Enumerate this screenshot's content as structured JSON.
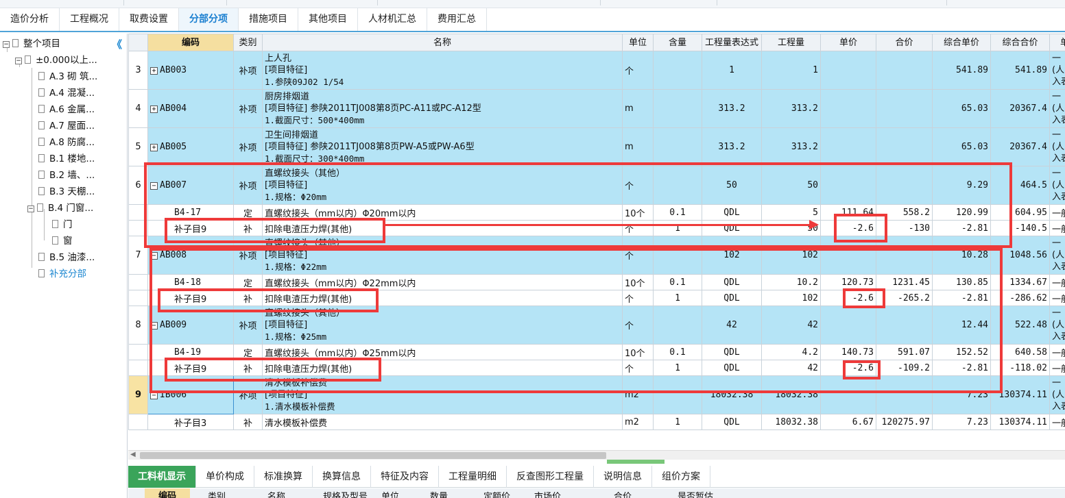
{
  "tabs": [
    "造价分析",
    "工程概况",
    "取费设置",
    "分部分项",
    "措施项目",
    "其他项目",
    "人材机汇总",
    "费用汇总"
  ],
  "active_tab": "分部分项",
  "tree": {
    "collapse_glyph": "《",
    "items": [
      {
        "label": "整个项目"
      },
      {
        "label": "±0.000以上..."
      },
      {
        "label": "A.3 砌 筑..."
      },
      {
        "label": "A.4 混凝..."
      },
      {
        "label": "A.6 金属..."
      },
      {
        "label": "A.7 屋面..."
      },
      {
        "label": "A.8 防腐..."
      },
      {
        "label": "B.1 楼地..."
      },
      {
        "label": "B.2 墙、..."
      },
      {
        "label": "B.3 天棚..."
      },
      {
        "label": "B.4 门窗..."
      },
      {
        "label": "门"
      },
      {
        "label": "窗"
      },
      {
        "label": "B.5 油漆..."
      },
      {
        "label": "补充分部"
      }
    ]
  },
  "columns": [
    "",
    "编码",
    "类别",
    "名称",
    "单位",
    "含量",
    "工程量表达式",
    "工程量",
    "单价",
    "合价",
    "综合单价",
    "综合合价",
    "单价"
  ],
  "rows": [
    {
      "rn": "3",
      "code": "AB003",
      "type": "补项",
      "name": [
        "上人孔",
        "[项目特征]",
        "1.参陕09J02 1/54"
      ],
      "unit": "个",
      "content": "",
      "expr": "1",
      "qty": "1",
      "price": "",
      "total": "",
      "cprice": "541.89",
      "ctotal": "541.89",
      "last": [
        "一",
        "(人",
        "入表"
      ]
    },
    {
      "rn": "4",
      "code": "AB004",
      "type": "补项",
      "name": [
        "厨房排烟道",
        "[项目特征]  参陕2011TJ008第8页PC-A11或PC-A12型",
        "1.截面尺寸：500*400mm"
      ],
      "unit": "m",
      "content": "",
      "expr": "313.2",
      "qty": "313.2",
      "price": "",
      "total": "",
      "cprice": "65.03",
      "ctotal": "20367.4",
      "last": [
        "一",
        "(人",
        "入表"
      ]
    },
    {
      "rn": "5",
      "code": "AB005",
      "type": "补项",
      "name": [
        "卫生间排烟道",
        "[项目特征]  参陕2011TJ008第8页PW-A5或PW-A6型",
        "1.截面尺寸：300*400mm"
      ],
      "unit": "m",
      "content": "",
      "expr": "313.2",
      "qty": "313.2",
      "price": "",
      "total": "",
      "cprice": "65.03",
      "ctotal": "20367.4",
      "last": [
        "一",
        "(人",
        "入表"
      ]
    },
    {
      "rn": "6",
      "code": "AB007",
      "type": "补项",
      "name": [
        "直螺纹接头（其他）",
        "[项目特征]",
        "1.规格：Φ20mm"
      ],
      "unit": "个",
      "content": "",
      "expr": "50",
      "qty": "50",
      "price": "",
      "total": "",
      "cprice": "9.29",
      "ctotal": "464.5",
      "last": [
        "一",
        "(人",
        "入表"
      ]
    },
    {
      "code": "B4-17",
      "type": "定",
      "name": [
        "直螺纹接头（mm以内）Φ20mm以内"
      ],
      "unit": "10个",
      "content": "0.1",
      "expr": "QDL",
      "qty": "5",
      "price": "111.64",
      "total": "558.2",
      "cprice": "120.99",
      "ctotal": "604.95",
      "last": [
        "一般"
      ]
    },
    {
      "code": "补子目9",
      "type": "补",
      "name": [
        "扣除电渣压力焊(其他)"
      ],
      "unit": "个",
      "content": "1",
      "expr": "QDL",
      "qty": "50",
      "price": "-2.6",
      "total": "-130",
      "cprice": "-2.81",
      "ctotal": "-140.5",
      "last": [
        "一般"
      ]
    },
    {
      "rn": "7",
      "code": "AB008",
      "type": "补项",
      "name": [
        "直螺纹接头（其他）",
        "[项目特征]",
        "1.规格：Φ22mm"
      ],
      "unit": "个",
      "content": "",
      "expr": "102",
      "qty": "102",
      "price": "",
      "total": "",
      "cprice": "10.28",
      "ctotal": "1048.56",
      "last": [
        "一",
        "(人",
        "入表"
      ]
    },
    {
      "code": "B4-18",
      "type": "定",
      "name": [
        "直螺纹接头（mm以内）Φ22mm以内"
      ],
      "unit": "10个",
      "content": "0.1",
      "expr": "QDL",
      "qty": "10.2",
      "price": "120.73",
      "total": "1231.45",
      "cprice": "130.85",
      "ctotal": "1334.67",
      "last": [
        "一般"
      ]
    },
    {
      "code": "补子目9",
      "type": "补",
      "name": [
        "扣除电渣压力焊(其他)"
      ],
      "unit": "个",
      "content": "1",
      "expr": "QDL",
      "qty": "102",
      "price": "-2.6",
      "total": "-265.2",
      "cprice": "-2.81",
      "ctotal": "-286.62",
      "last": [
        "一般"
      ]
    },
    {
      "rn": "8",
      "code": "AB009",
      "type": "补项",
      "name": [
        "直螺纹接头（其他）",
        "[项目特征]",
        "1.规格：Φ25mm"
      ],
      "unit": "个",
      "content": "",
      "expr": "42",
      "qty": "42",
      "price": "",
      "total": "",
      "cprice": "12.44",
      "ctotal": "522.48",
      "last": [
        "一",
        "(人",
        "入表"
      ]
    },
    {
      "code": "B4-19",
      "type": "定",
      "name": [
        "直螺纹接头（mm以内）Φ25mm以内"
      ],
      "unit": "10个",
      "content": "0.1",
      "expr": "QDL",
      "qty": "4.2",
      "price": "140.73",
      "total": "591.07",
      "cprice": "152.52",
      "ctotal": "640.58",
      "last": [
        "一般"
      ]
    },
    {
      "code": "补子目9",
      "type": "补",
      "name": [
        "扣除电渣压力焊(其他)"
      ],
      "unit": "个",
      "content": "1",
      "expr": "QDL",
      "qty": "42",
      "price": "-2.6",
      "total": "-109.2",
      "cprice": "-2.81",
      "ctotal": "-118.02",
      "last": [
        "一般"
      ]
    },
    {
      "rn": "9",
      "code": "IB006",
      "type": "补项",
      "name": [
        "清水模板补偿费",
        "[项目特征]",
        "1.清水模板补偿费"
      ],
      "unit": "m2",
      "content": "",
      "expr": "18032.38",
      "qty": "18032.38",
      "price": "",
      "total": "",
      "cprice": "7.23",
      "ctotal": "130374.11",
      "last": [
        "一",
        "(人",
        "入表"
      ]
    },
    {
      "code": "补子目3",
      "type": "补",
      "name": [
        "清水模板补偿费"
      ],
      "unit": "m2",
      "content": "1",
      "expr": "QDL",
      "qty": "18032.38",
      "price": "6.67",
      "total": "120275.97",
      "cprice": "7.23",
      "ctotal": "130374.11",
      "last": [
        "一般"
      ]
    }
  ],
  "bottom_tabs": [
    "工料机显示",
    "单价构成",
    "标准换算",
    "换算信息",
    "特征及内容",
    "工程量明细",
    "反查图形工程量",
    "说明信息",
    "组价方案"
  ],
  "bottom_columns": [
    "编码",
    "类别",
    "名称",
    "规格及型号",
    "单位",
    "数量",
    "定额价",
    "市场价",
    "合价",
    "是否暂估"
  ],
  "colors": {
    "item_row": "#b5e4f6",
    "highlight": "#ee3a3a",
    "active_bottom_tab": "#3aa45a",
    "active_tab": "#1a7fd0"
  }
}
